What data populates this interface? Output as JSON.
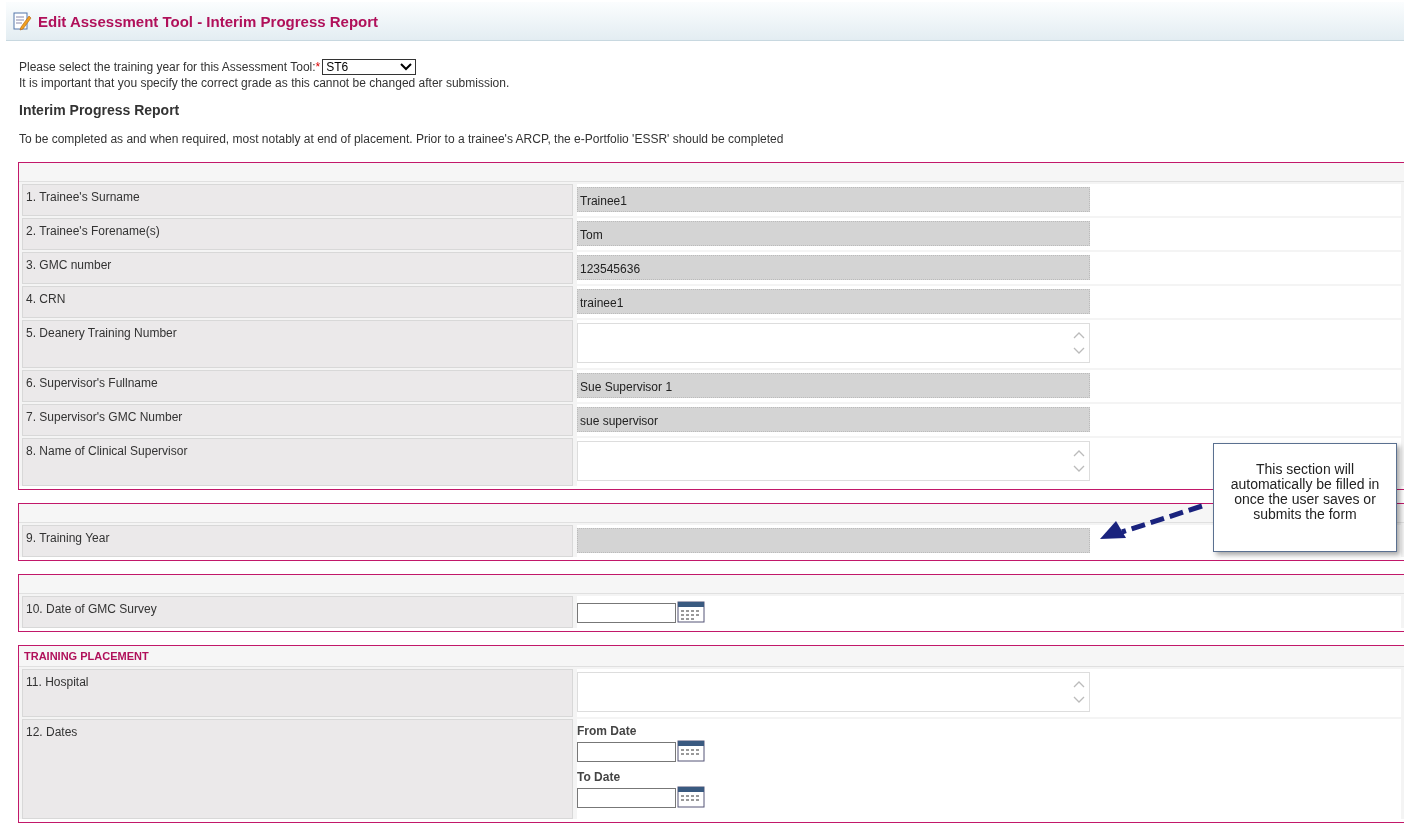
{
  "header": {
    "title": "Edit Assessment Tool - Interim Progress Report"
  },
  "year_select": {
    "label": "Please select the training year for this Assessment Tool:",
    "required_mark": "*",
    "value": "ST6",
    "note": "It is important that you specify the correct grade as this cannot be changed after submission."
  },
  "report": {
    "heading": "Interim Progress Report",
    "intro": "To be completed as and when required, most notably at end of placement. Prior to a trainee's ARCP, the e-Portfolio 'ESSR' should be completed"
  },
  "sections": [
    {
      "rows": [
        {
          "label": "1. Trainee's Surname",
          "kind": "readonly",
          "value": "Trainee1"
        },
        {
          "label": "2. Trainee's Forename(s)",
          "kind": "readonly",
          "value": "Tom"
        },
        {
          "label": "3. GMC number",
          "kind": "readonly",
          "value": "123545636"
        },
        {
          "label": "4. CRN",
          "kind": "readonly",
          "value": "trainee1"
        },
        {
          "label": "5. Deanery Training Number",
          "kind": "textarea"
        },
        {
          "label": "6. Supervisor's Fullname",
          "kind": "readonly",
          "value": "Sue Supervisor 1"
        },
        {
          "label": "7. Supervisor's GMC Number",
          "kind": "readonly",
          "value": "sue supervisor"
        },
        {
          "label": "8. Name of Clinical Supervisor",
          "kind": "textarea"
        }
      ]
    },
    {
      "rows": [
        {
          "label": "9. Training Year",
          "kind": "readonly"
        }
      ]
    },
    {
      "rows": [
        {
          "label": "10. Date of GMC Survey",
          "kind": "date"
        }
      ]
    },
    {
      "heading": "TRAINING PLACEMENT",
      "rows": [
        {
          "label": "11. Hospital",
          "kind": "textarea"
        },
        {
          "label": "12. Dates",
          "kind": "daterange",
          "from_label": "From Date",
          "to_label": "To Date"
        }
      ]
    }
  ],
  "callout": {
    "text": "This section will automatically be filled in once the user saves or submits the form"
  }
}
